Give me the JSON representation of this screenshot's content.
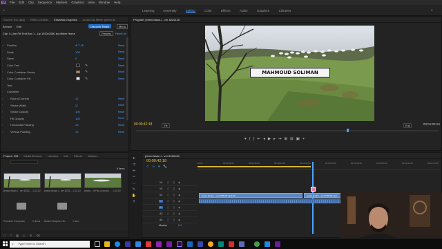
{
  "menu": [
    "File",
    "Edit",
    "Clip",
    "Sequence",
    "Markers",
    "Graphics",
    "View",
    "Window",
    "Help"
  ],
  "workspaces": [
    "Learning",
    "Assembly",
    "Editing",
    "Color",
    "Effects",
    "Audio",
    "Graphics",
    "Libraries"
  ],
  "left_tabs": [
    "Source: (no clips)",
    "Effect Controls",
    "Essential Graphics",
    "Audio Clip Mixer: jenelo fa"
  ],
  "eg": {
    "browse": "Browse",
    "edit": "Edit",
    "discover": "Discover Radio",
    "menu": "Menu"
  },
  "clip_title": "Clip: 5-Line Fill Text Box 1 - Up 1920x1080 by Mister Horse",
  "presets": "Presets",
  "reset_all": "Reset All",
  "params": [
    {
      "label": "Position",
      "value": "⊕ ⤡ ⊕",
      "type": "val"
    },
    {
      "label": "Scale",
      "value": "100",
      "type": "val"
    },
    {
      "label": "Skew",
      "value": "0",
      "type": "val"
    },
    {
      "label": "Color Text",
      "color": "#111111",
      "type": "color"
    },
    {
      "label": "Color Container Stroke",
      "color": "#e8822a",
      "type": "color"
    },
    {
      "label": "Color Container Fill",
      "color": "#f5f5f5",
      "type": "color"
    },
    {
      "label": "Text",
      "type": "section"
    },
    {
      "label": "Container",
      "type": "section"
    },
    {
      "label": "Round Corners",
      "value": "12",
      "type": "val"
    },
    {
      "label": "Stroke Width",
      "value": "☑",
      "type": "val"
    },
    {
      "label": "Stroke Opacity",
      "value": "100",
      "type": "val"
    },
    {
      "label": "Fill Opacity",
      "value": "100",
      "type": "val"
    },
    {
      "label": "Horizontal Padding",
      "value": "10",
      "type": "val"
    },
    {
      "label": "Vertical Padding",
      "value": "10",
      "type": "val"
    }
  ],
  "reset": "Reset",
  "program_title": "Program: jenelo fasan-l - ver 8226136",
  "lower_third_text": "MAHMOUD SOLIMAN",
  "timecode_left": "00:00:42:18",
  "fit": "Fit",
  "timecode_right": "00:01:02:10",
  "full": "Full",
  "project_tabs": [
    "Project: 233",
    "Media Browser",
    "Libraries",
    "Info",
    "Effects",
    "Markers"
  ],
  "project_item_count": "6 Items",
  "project_items": [
    {
      "name": "jenelo fasan-l - ver 8226…",
      "dur": "1:02:10"
    },
    {
      "name": "jenelo fasan-l - ver 8226…",
      "dur": "1:02:10"
    },
    {
      "name": "jenelo - ril Fan-a woodl…",
      "dur": "1:02:00"
    },
    {
      "name": "Premiere Composer",
      "dur": "0 items"
    },
    {
      "name": "Motion Graphics Te…",
      "dur": "1 item"
    }
  ],
  "tl_tab": "jenelo fasan-l - ver 8226136",
  "tl_timecode": "00:00:42:18",
  "ruler": [
    "00:00",
    "00:00:08:00",
    "00:00:16:00",
    "00:00:24:00",
    "00:00:32:00",
    "00:00:40:00",
    "00:00:48:00",
    "00:00:56:00",
    "00:01:04:00",
    "00:01:12:00"
  ],
  "tracks": [
    "V4",
    "V3",
    "V2",
    "V1",
    "A1",
    "A2",
    "A3"
  ],
  "clip_label_a": "jenelo fasan-l - ver 8226136.mp4 [V]",
  "clip_label_b": "jenelo fasan-l - ver 8226136.mp4",
  "master": "Master",
  "master_val": "0.0",
  "search_placeholder": "Type here to search",
  "colors": {
    "accent": "#4da3ff",
    "orange": "#e8822a",
    "panel": "#232323",
    "bg": "#1d1d1d"
  }
}
